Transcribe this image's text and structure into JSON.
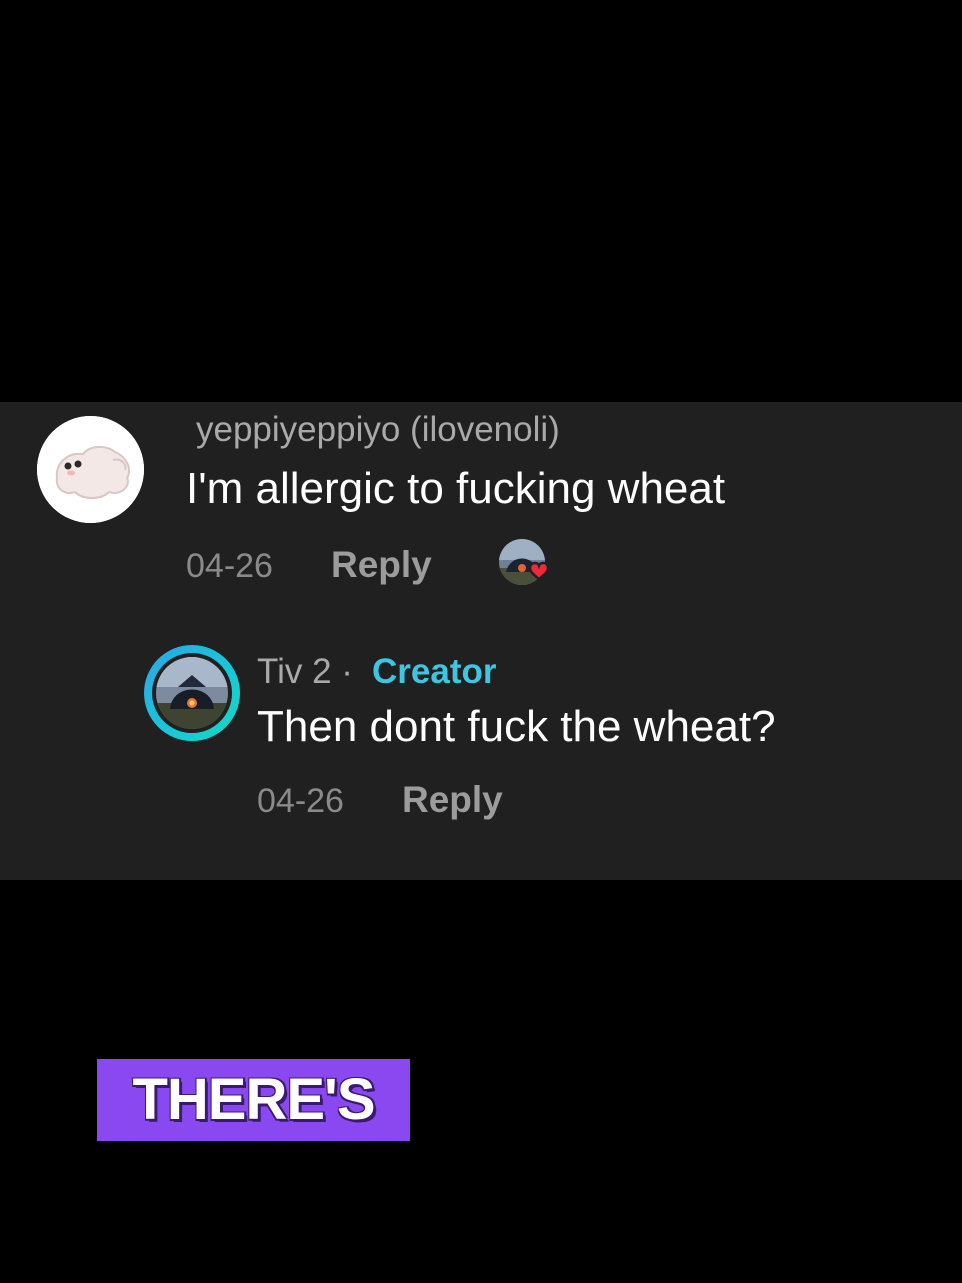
{
  "comments": [
    {
      "username": "yeppiyeppiyo (ilovenoli)",
      "text": "I'm allergic to fucking wheat",
      "date": "04-26",
      "reply_label": "Reply",
      "avatar_icon": "ghost-avatar",
      "liked_by_creator": true
    },
    {
      "username": "Tiv 2 ·",
      "badge": "Creator",
      "text": "Then dont fuck the wheat?",
      "date": "04-26",
      "reply_label": "Reply",
      "avatar_icon": "creator-avatar"
    }
  ],
  "caption": {
    "text": "THERE'S"
  },
  "colors": {
    "panel_background": "#202020",
    "creator_badge": "#3ec6e0",
    "like_heart": "#f0283c",
    "caption_background": "#8a49f0"
  }
}
